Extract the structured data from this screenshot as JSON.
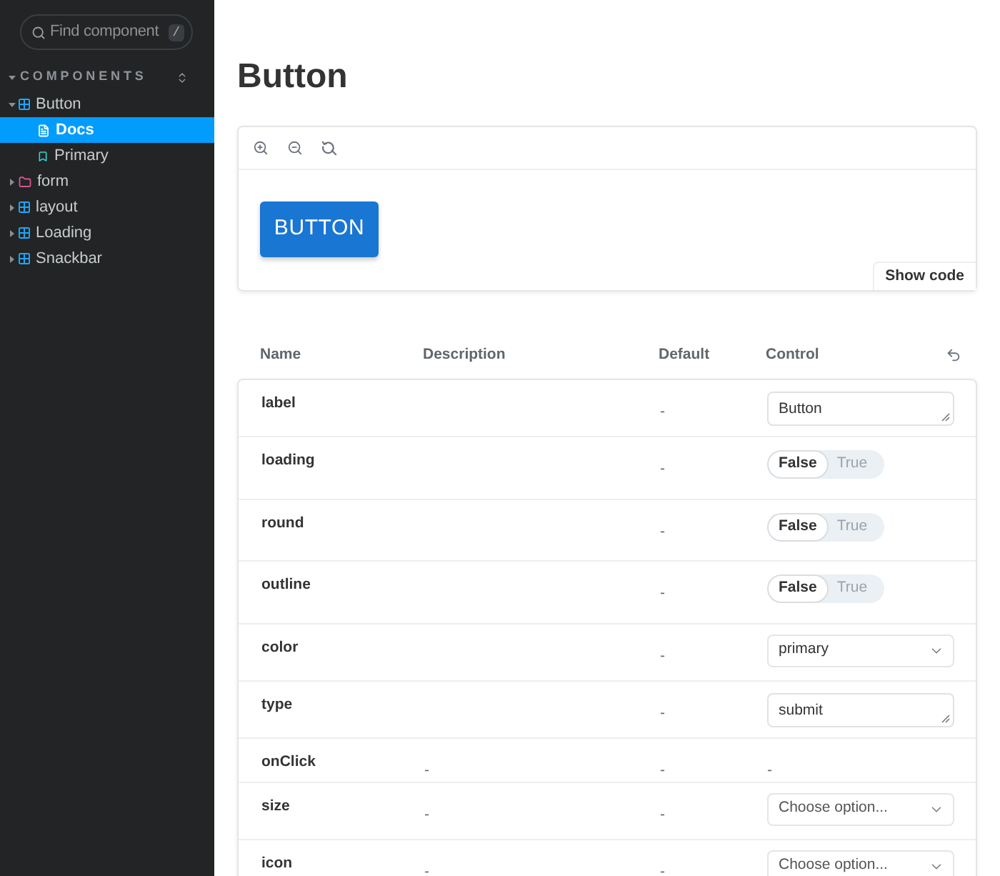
{
  "sidebar": {
    "search": {
      "placeholder": "Find component",
      "shortcut": "/"
    },
    "section": {
      "label": "COMPONENTS",
      "expanded": true
    },
    "tree": [
      {
        "label": "Button",
        "kind": "component",
        "expanded": true,
        "selected": false,
        "children": [
          {
            "label": "Docs",
            "kind": "docs",
            "selected": true
          },
          {
            "label": "Primary",
            "kind": "story",
            "selected": false
          }
        ]
      },
      {
        "label": "form",
        "kind": "folder",
        "expanded": false,
        "selected": false
      },
      {
        "label": "layout",
        "kind": "component",
        "expanded": false,
        "selected": false
      },
      {
        "label": "Loading",
        "kind": "component",
        "expanded": false,
        "selected": false
      },
      {
        "label": "Snackbar",
        "kind": "component",
        "expanded": false,
        "selected": false
      }
    ]
  },
  "main": {
    "title": "Button",
    "preview": {
      "button_label": "BUTTON",
      "show_code": "Show code"
    },
    "args_table": {
      "columns": [
        "Name",
        "Description",
        "Default",
        "Control"
      ],
      "rows": [
        {
          "name": "label",
          "default": "-",
          "control": {
            "kind": "text",
            "value": "Button"
          }
        },
        {
          "name": "loading",
          "default": "-",
          "control": {
            "kind": "boolean",
            "options": [
              {
                "label": "False",
                "selected": true
              },
              {
                "label": "True",
                "selected": false
              }
            ]
          }
        },
        {
          "name": "round",
          "default": "-",
          "control": {
            "kind": "boolean",
            "options": [
              {
                "label": "False",
                "selected": true
              },
              {
                "label": "True",
                "selected": false
              }
            ]
          }
        },
        {
          "name": "outline",
          "default": "-",
          "control": {
            "kind": "boolean",
            "options": [
              {
                "label": "False",
                "selected": true
              },
              {
                "label": "True",
                "selected": false
              }
            ]
          }
        },
        {
          "name": "color",
          "default": "-",
          "control": {
            "kind": "select",
            "value": "primary"
          }
        },
        {
          "name": "type",
          "default": "-",
          "control": {
            "kind": "text",
            "value": "submit"
          }
        },
        {
          "name": "onClick",
          "description": "-",
          "default": "-",
          "control": {
            "kind": "none",
            "text": "-"
          }
        },
        {
          "name": "size",
          "description": "-",
          "default": "-",
          "control": {
            "kind": "select",
            "placeholder": "Choose option..."
          }
        },
        {
          "name": "icon",
          "description": "-",
          "default": "-",
          "control": {
            "kind": "select",
            "placeholder": "Choose option..."
          }
        }
      ]
    }
  }
}
